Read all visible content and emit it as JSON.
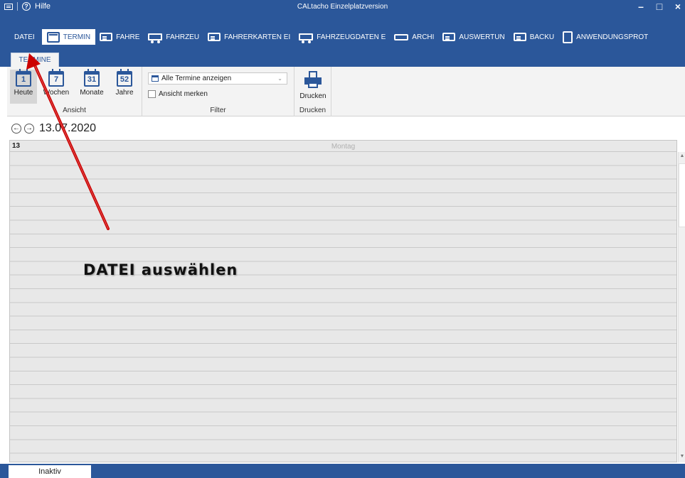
{
  "titlebar": {
    "help_label": "Hilfe",
    "title": "CALtacho Einzelplatzversion",
    "minimize": "–",
    "maximize": "□",
    "close": "×"
  },
  "menu": {
    "file": "DATEI",
    "items": [
      {
        "label": "TERMIN",
        "icon": "calendar-icon"
      },
      {
        "label": "FAHRE",
        "icon": "driver-card-icon"
      },
      {
        "label": "FAHRZEU",
        "icon": "truck-icon"
      },
      {
        "label": "FAHRERKARTEN EI",
        "icon": "card-import-icon"
      },
      {
        "label": "FAHRZEUGDATEN E",
        "icon": "truck-import-icon"
      },
      {
        "label": "ARCHI",
        "icon": "archive-icon"
      },
      {
        "label": "AUSWERTUN",
        "icon": "evaluation-icon"
      },
      {
        "label": "BACKU",
        "icon": "backup-icon"
      },
      {
        "label": "ANWENDUNGSPROT",
        "icon": "log-icon"
      }
    ]
  },
  "ribbon": {
    "tab_label": "TERMINE",
    "view_group": {
      "label": "Ansicht",
      "buttons": [
        {
          "label": "Heute",
          "day": "1"
        },
        {
          "label": "Wochen",
          "day": "7"
        },
        {
          "label": "Monate",
          "day": "31"
        },
        {
          "label": "Jahre",
          "day": "52"
        }
      ]
    },
    "filter_group": {
      "label": "Filter",
      "select_value": "Alle Termine anzeigen",
      "checkbox_label": "Ansicht merken"
    },
    "print_group": {
      "label": "Drucken",
      "button_label": "Drucken"
    }
  },
  "datebar": {
    "prev": "←",
    "next": "→",
    "date": "13.07.2020"
  },
  "dayview": {
    "day_number": "13",
    "day_name": "Montag"
  },
  "statusbar": {
    "tab_label": "Inaktiv"
  },
  "annotation": {
    "text": "DATEI auswählen",
    "arrow_color": "#cc0000"
  }
}
